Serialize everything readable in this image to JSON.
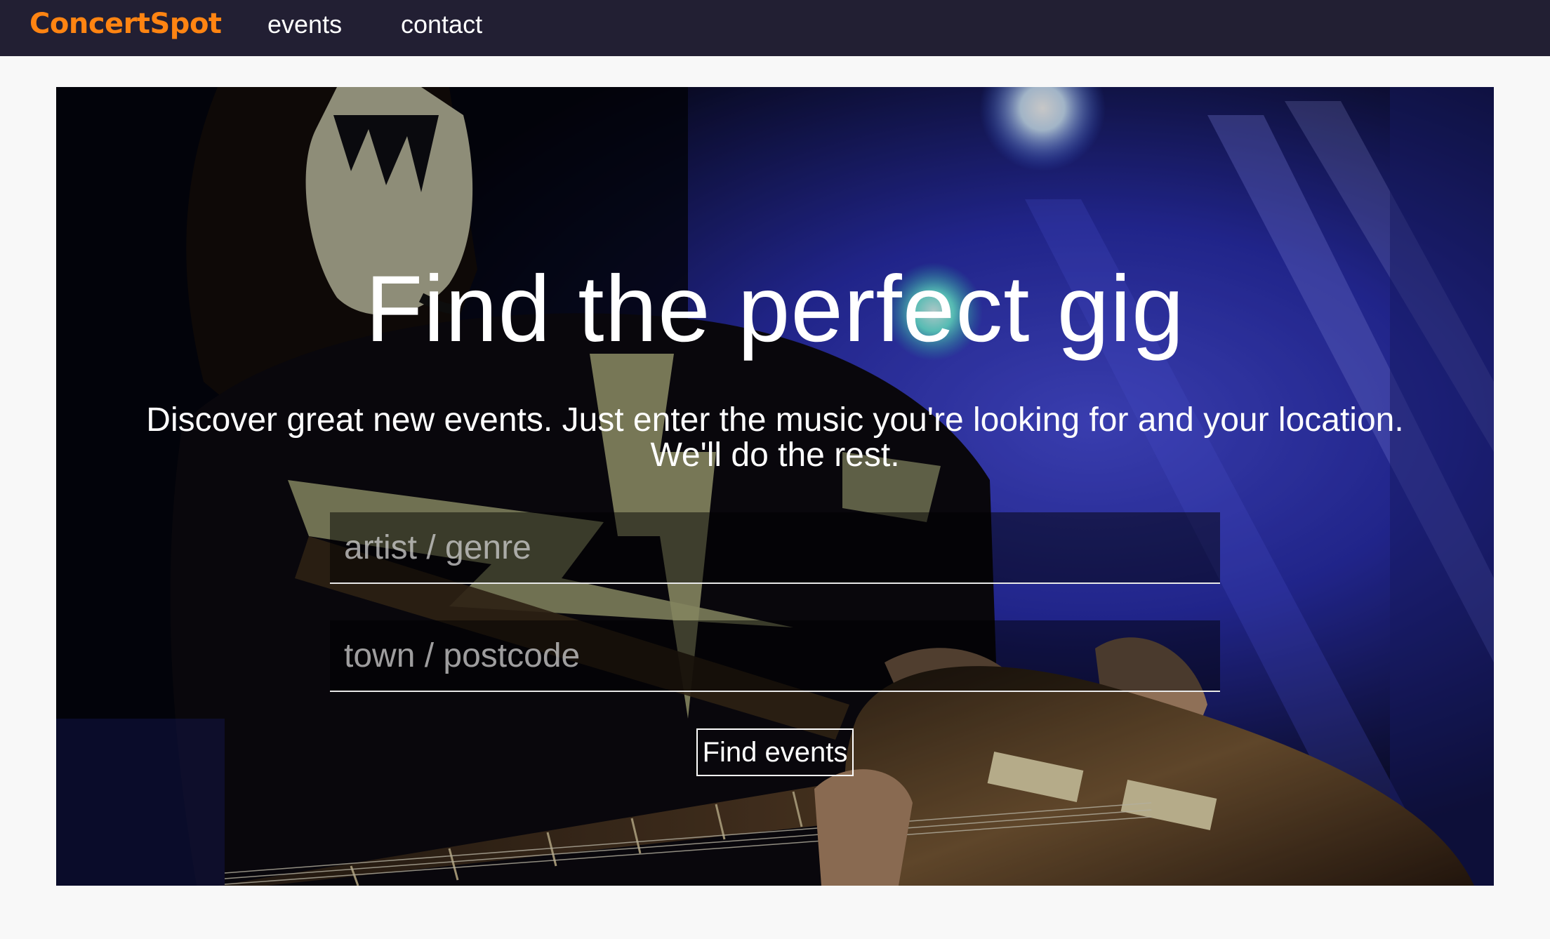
{
  "nav": {
    "brand": "ConcertSpot",
    "links": [
      "events",
      "contact"
    ]
  },
  "hero": {
    "headline": "Find the perfect gig",
    "subtitle_line1": "Discover great new events. Just enter the music you're looking for and your location.",
    "subtitle_line2": "We'll do the rest.",
    "artist_placeholder": "artist / genre",
    "location_placeholder": "town / postcode",
    "artist_value": "",
    "location_value": "",
    "button_label": "Find events",
    "background_image": "concert-guitarist-photo"
  },
  "colors": {
    "navbar_bg": "#221f33",
    "brand": "#ff8412",
    "page_bg": "#f8f8f8",
    "text_light": "#ffffff",
    "stage_blue": "#2a2fb0"
  }
}
